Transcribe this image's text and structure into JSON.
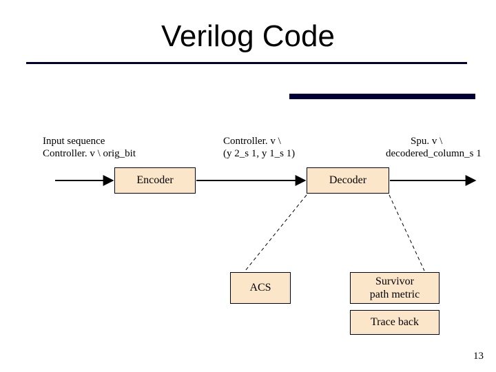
{
  "title": "Verilog Code",
  "labels": {
    "input_seq_l1": "Input sequence",
    "input_seq_l2": "Controller. v \\ orig_bit",
    "mid_l1": "Controller. v \\",
    "mid_l2": "(y 2_s 1, y 1_s 1)",
    "out_l1": "Spu. v \\",
    "out_l2": "decodered_column_s 1"
  },
  "boxes": {
    "encoder": "Encoder",
    "decoder": "Decoder",
    "acs": "ACS",
    "survivor": "Survivor\npath metric",
    "traceback": "Trace back"
  },
  "colors": {
    "box_fill": "#fce6c9",
    "rule": "#000033"
  },
  "page_number": "13"
}
